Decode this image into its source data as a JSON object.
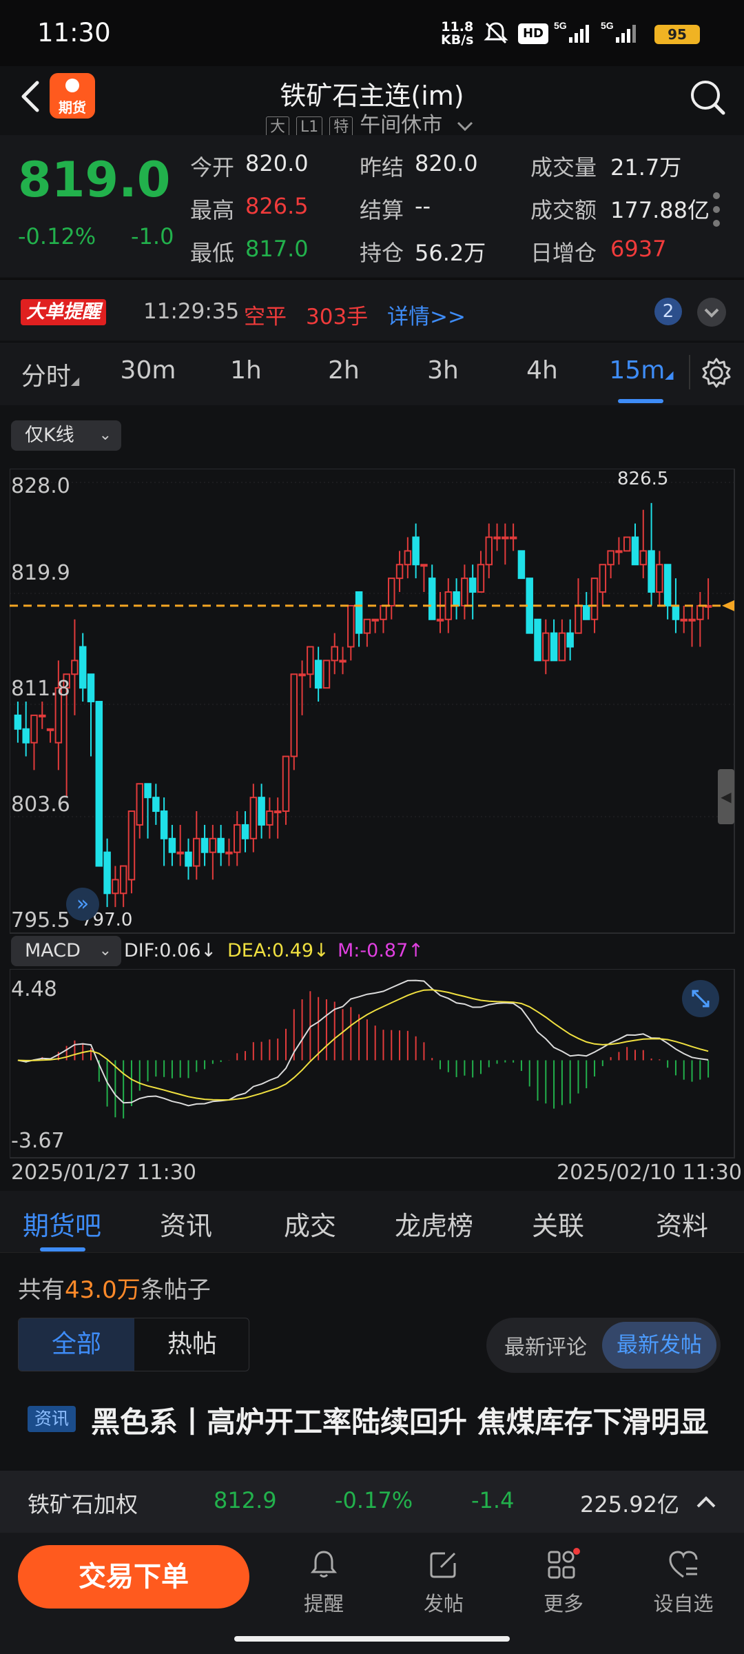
{
  "status": {
    "time": "11:30",
    "net_speed": "11.8",
    "net_unit": "KB/s",
    "icons": "HD 5G 5G",
    "battery": "95"
  },
  "header": {
    "logo_text": "期货",
    "title": "铁矿石主连(im)",
    "tags": [
      "大",
      "L1",
      "特"
    ],
    "session": "午间休市"
  },
  "quote": {
    "price": "819.0",
    "change_pct": "-0.12%",
    "change": "-1.0",
    "fields": [
      {
        "label": "今开",
        "value": "820.0",
        "color": ""
      },
      {
        "label": "昨结",
        "value": "820.0",
        "color": ""
      },
      {
        "label": "成交量",
        "value": "21.7万",
        "color": ""
      },
      {
        "label": "最高",
        "value": "826.5",
        "color": "red"
      },
      {
        "label": "结算",
        "value": "--",
        "color": ""
      },
      {
        "label": "成交额",
        "value": "177.88亿",
        "color": ""
      },
      {
        "label": "最低",
        "value": "817.0",
        "color": "green"
      },
      {
        "label": "持仓",
        "value": "56.2万",
        "color": ""
      },
      {
        "label": "日增仓",
        "value": "6937",
        "color": "red"
      }
    ]
  },
  "alert": {
    "badge": "大单提醒",
    "time": "11:29:35",
    "type": "空平",
    "size": "303手",
    "link": "详情>>",
    "count": "2"
  },
  "timeframes": [
    "分时",
    "30m",
    "1h",
    "2h",
    "3h",
    "4h",
    "15m"
  ],
  "chart": {
    "mode_dropdown": "仅K线",
    "indicator_dropdown": "MACD",
    "price_labels": [
      "828.0",
      "819.9",
      "811.8",
      "803.6",
      "795.5"
    ],
    "high_mark": "826.5",
    "low_mark": "797.0",
    "dif": "DIF:0.06↓",
    "dea": "DEA:0.49↓",
    "m": "M:-0.87↑",
    "macd_top": "4.48",
    "macd_bottom": "-3.67",
    "date_start": "2025/01/27 11:30",
    "date_end": "2025/02/10 11:30"
  },
  "chart_data": {
    "type": "candlestick",
    "ylim": [
      795.5,
      828.0
    ],
    "last_price": 819.0,
    "candles": [
      [
        811,
        812,
        809,
        810
      ],
      [
        810,
        812,
        808,
        809
      ],
      [
        809,
        811,
        807,
        811
      ],
      [
        811,
        812,
        810,
        811
      ],
      [
        810,
        810,
        809,
        810
      ],
      [
        809,
        815,
        807,
        813
      ],
      [
        813,
        814,
        805,
        814
      ],
      [
        814,
        818,
        811,
        815
      ],
      [
        816,
        817,
        812,
        813
      ],
      [
        814,
        814,
        808,
        812
      ],
      [
        812,
        812,
        800,
        800
      ],
      [
        801,
        802,
        797,
        798
      ],
      [
        798,
        800,
        797,
        799
      ],
      [
        798,
        800,
        797,
        800
      ],
      [
        799,
        804,
        798,
        804
      ],
      [
        803,
        806,
        802,
        806
      ],
      [
        806,
        806,
        802,
        805
      ],
      [
        805,
        806,
        803,
        804
      ],
      [
        804,
        805,
        800,
        802
      ],
      [
        802,
        803,
        800,
        801
      ],
      [
        801,
        803,
        800,
        801
      ],
      [
        801,
        802,
        799,
        800
      ],
      [
        800,
        804,
        799,
        802
      ],
      [
        802,
        803,
        800,
        801
      ],
      [
        801,
        803,
        799,
        802
      ],
      [
        802,
        803,
        800,
        801
      ],
      [
        801,
        802,
        800,
        801
      ],
      [
        801,
        804,
        800,
        803
      ],
      [
        803,
        804,
        801,
        802
      ],
      [
        802,
        806,
        801,
        805
      ],
      [
        805,
        806,
        802,
        803
      ],
      [
        803,
        805,
        802,
        804
      ],
      [
        804,
        805,
        802,
        804
      ],
      [
        804,
        808,
        803,
        808
      ],
      [
        808,
        814,
        807,
        814
      ],
      [
        814,
        815,
        811,
        814
      ],
      [
        814,
        816,
        813,
        816
      ],
      [
        815,
        816,
        812,
        813
      ],
      [
        813,
        815,
        813,
        815
      ],
      [
        815,
        817,
        814,
        816
      ],
      [
        815,
        816,
        814,
        815
      ],
      [
        816,
        819,
        815,
        819
      ],
      [
        820,
        820,
        816,
        817
      ],
      [
        817,
        818,
        816,
        818
      ],
      [
        818,
        818,
        817,
        818
      ],
      [
        818,
        819,
        817,
        819
      ],
      [
        819,
        821,
        818,
        821
      ],
      [
        821,
        823,
        820,
        822
      ],
      [
        822,
        824,
        821,
        823
      ],
      [
        824,
        825,
        821,
        822
      ],
      [
        822,
        822,
        820,
        822
      ],
      [
        821,
        822,
        819,
        818
      ],
      [
        818,
        820,
        817,
        818
      ],
      [
        818,
        821,
        817,
        820
      ],
      [
        820,
        821,
        818,
        819
      ],
      [
        819,
        822,
        818,
        821
      ],
      [
        821,
        822,
        818,
        820
      ],
      [
        820,
        823,
        820,
        822
      ],
      [
        822,
        825,
        821,
        824
      ],
      [
        824,
        825,
        823,
        824
      ],
      [
        824,
        825,
        822,
        824
      ],
      [
        824,
        825,
        823,
        824
      ],
      [
        823,
        823,
        821,
        821
      ],
      [
        821,
        821,
        818,
        817
      ],
      [
        818,
        818,
        815,
        815
      ],
      [
        815,
        818,
        814,
        817
      ],
      [
        817,
        818,
        815,
        815
      ],
      [
        815,
        818,
        815,
        817
      ],
      [
        817,
        818,
        815,
        816
      ],
      [
        817,
        821,
        817,
        819
      ],
      [
        819,
        820,
        818,
        818
      ],
      [
        818,
        821,
        817,
        821
      ],
      [
        820,
        822,
        819,
        822
      ],
      [
        822,
        823,
        821,
        823
      ],
      [
        823,
        824,
        822,
        823
      ],
      [
        823,
        824,
        823,
        824
      ],
      [
        824,
        825,
        822,
        822
      ],
      [
        822,
        826,
        821,
        823
      ],
      [
        823,
        826.5,
        819,
        820
      ],
      [
        820,
        823,
        819,
        822
      ],
      [
        822,
        822,
        818,
        819
      ],
      [
        819,
        821,
        817,
        818
      ],
      [
        818,
        819,
        817,
        818
      ],
      [
        818,
        819,
        816,
        818
      ],
      [
        818,
        820,
        816,
        819
      ],
      [
        819,
        821,
        818,
        819
      ]
    ]
  },
  "forum": {
    "tabs": [
      "期货吧",
      "资讯",
      "成交",
      "龙虎榜",
      "关联",
      "资料"
    ],
    "count_prefix": "共有",
    "count_value": "43.0万",
    "count_suffix": "条帖子",
    "filter_all": "全部",
    "filter_hot": "热帖",
    "sort_comment": "最新评论",
    "sort_post": "最新发帖",
    "news_tag": "资讯",
    "news_title": "黑色系丨高炉开工率陆续回升 焦煤库存下滑明显"
  },
  "ticker": {
    "name": "铁矿石加权",
    "price": "812.9",
    "pct": "-0.17%",
    "change": "-1.4",
    "amount": "225.92亿"
  },
  "bottom_nav": {
    "trade": "交易下单",
    "items": [
      "提醒",
      "发帖",
      "更多",
      "设自选"
    ]
  }
}
